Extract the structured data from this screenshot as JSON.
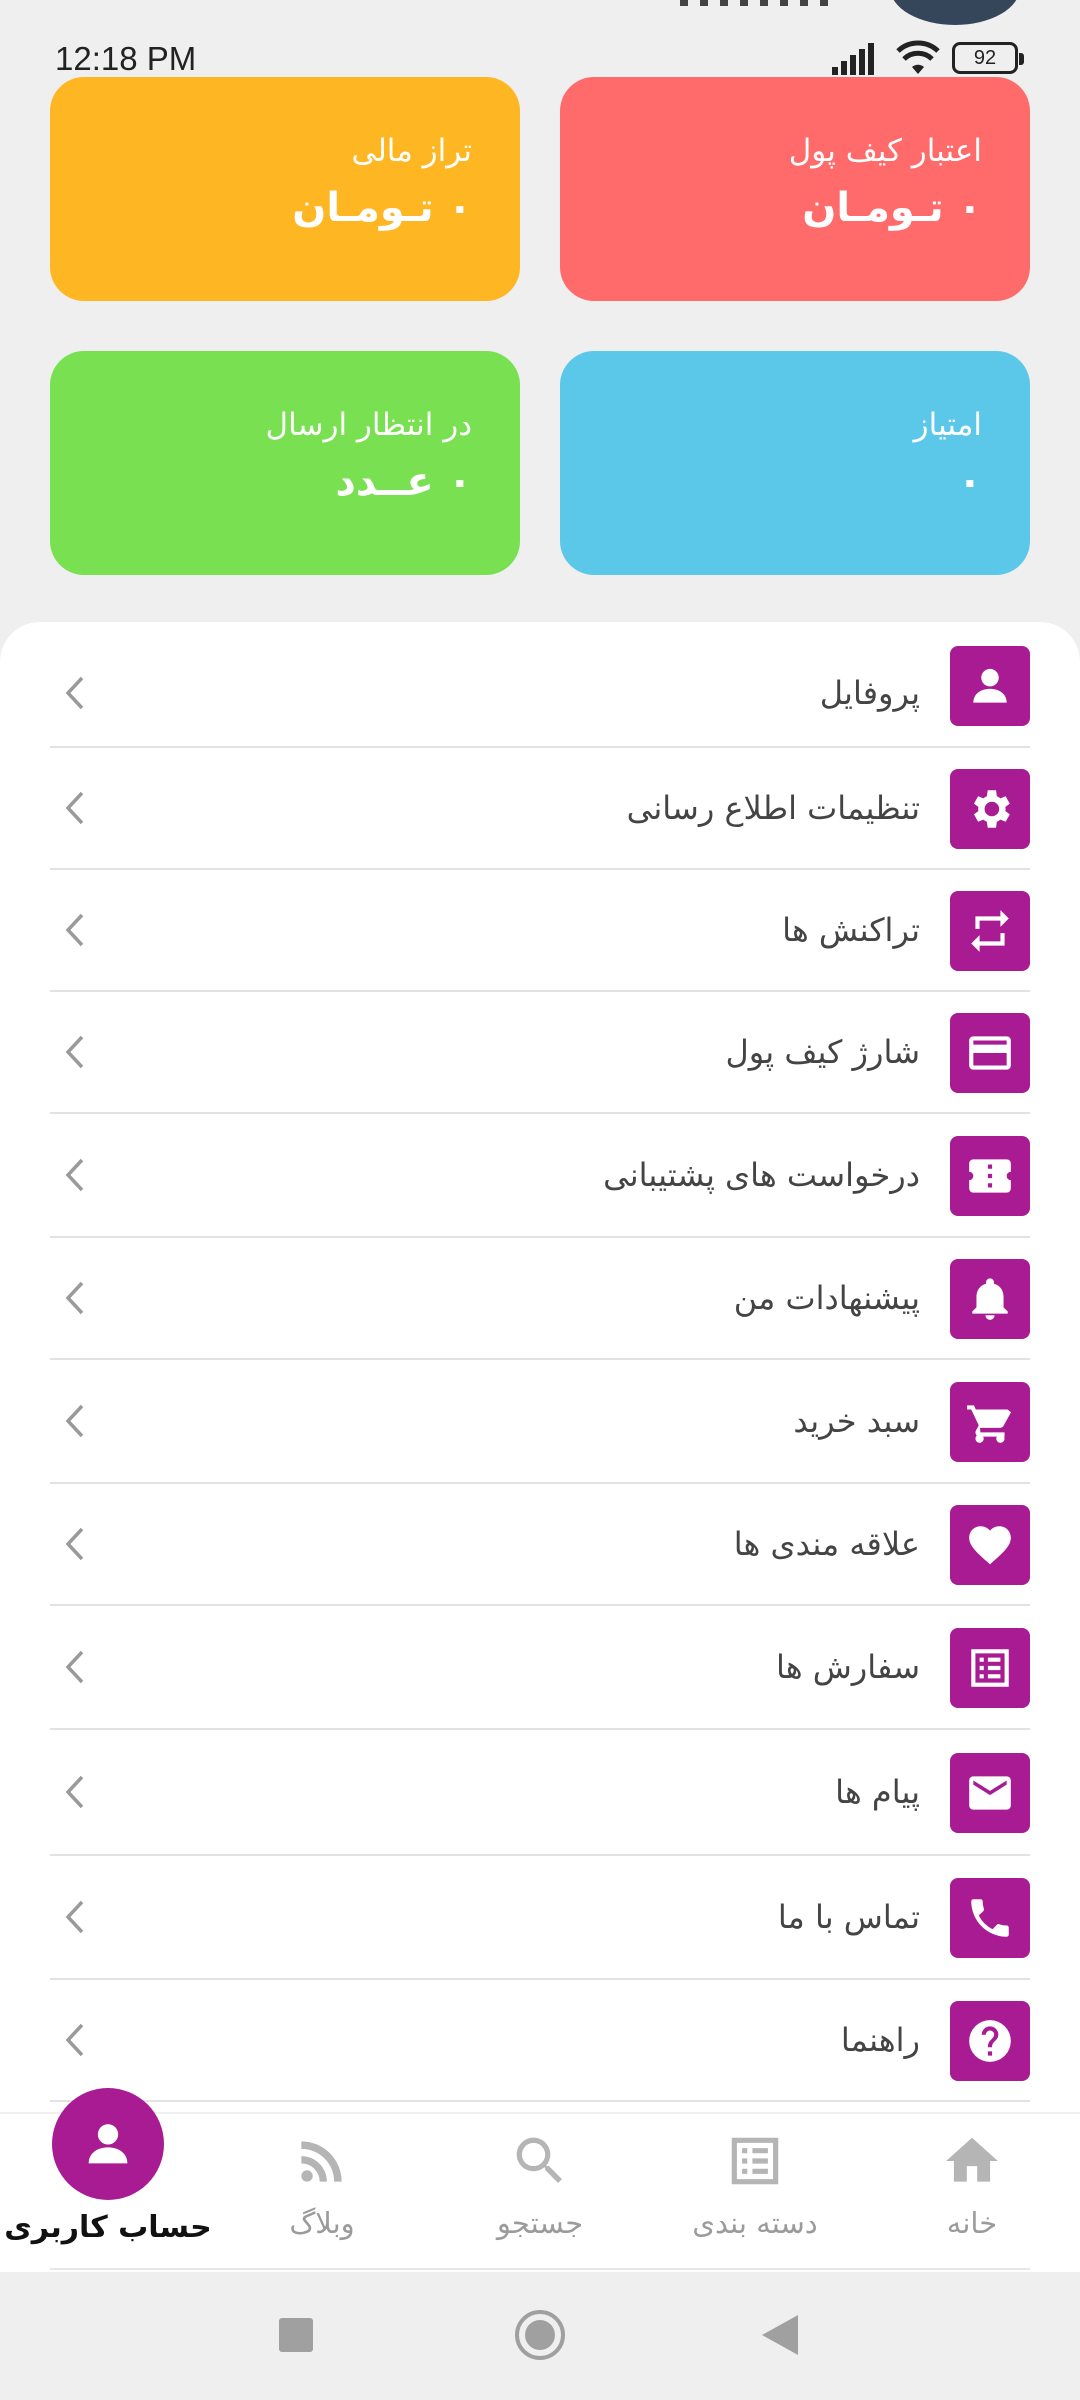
{
  "status_bar": {
    "time": "12:18 PM",
    "battery": "92"
  },
  "cards": {
    "wallet_credit": {
      "label": "اعتبار کیف پول",
      "value": "۰ تـومـان",
      "color": "#ff6b6b"
    },
    "financial_balance": {
      "label": "تراز مالی",
      "value": "۰ تـومـان",
      "color": "#ffb623"
    },
    "points": {
      "label": "امتیاز",
      "value": "۰",
      "color": "#5bc8ea"
    },
    "pending_shipment": {
      "label": "در انتظار ارسال",
      "value": "۰ عــدد",
      "color": "#79e052"
    }
  },
  "menu": {
    "accent": "#a81b93",
    "items": [
      {
        "label": "پروفایل",
        "icon": "person-icon"
      },
      {
        "label": "تنظیمات اطلاع رسانی",
        "icon": "gear-icon"
      },
      {
        "label": "تراکنش ها",
        "icon": "repeat-icon"
      },
      {
        "label": "شارژ کیف پول",
        "icon": "credit-card-icon"
      },
      {
        "label": "درخواست های پشتیبانی",
        "icon": "ticket-icon"
      },
      {
        "label": "پیشنهادات من",
        "icon": "bell-icon"
      },
      {
        "label": "سبد خرید",
        "icon": "cart-icon"
      },
      {
        "label": "علاقه مندی ها",
        "icon": "heart-icon"
      },
      {
        "label": "سفارش ها",
        "icon": "list-icon"
      },
      {
        "label": "پیام ها",
        "icon": "mail-icon"
      },
      {
        "label": "تماس با ما",
        "icon": "phone-icon"
      },
      {
        "label": "راهنما",
        "icon": "help-icon"
      }
    ]
  },
  "bottom_nav": {
    "home": "خانه",
    "categories": "دسته بندی",
    "search": "جستجو",
    "blog": "وبلاگ",
    "account": "حساب کاربری"
  }
}
